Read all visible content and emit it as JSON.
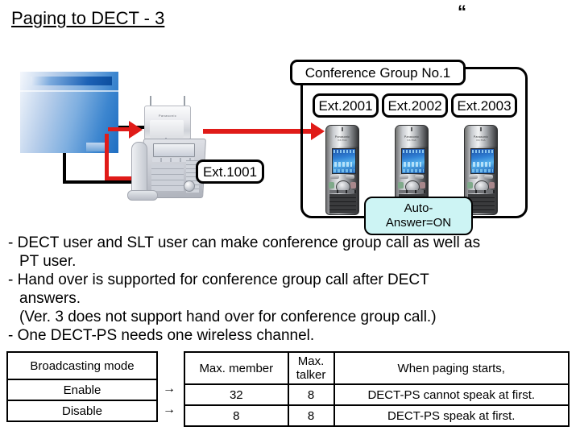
{
  "slide": {
    "title": "Paging to DECT - 3",
    "quote_mark": "“"
  },
  "diagram": {
    "conference_group_label": "Conference Group No.1",
    "extension_labels": [
      "Ext.2001",
      "Ext.2002",
      "Ext.2003"
    ],
    "pt_extension_label": "Ext.1001",
    "auto_answer": {
      "line1": "Auto-",
      "line2": "Answer=ON"
    },
    "devices": {
      "pbx": "pbx-main-unit",
      "cell_station": "dect-cell-station",
      "desk_phone": "proprietary-desk-telephone",
      "handsets": [
        "dect-handset-1",
        "dect-handset-2",
        "dect-handset-3"
      ]
    },
    "colors": {
      "arrow_red": "#e01b18",
      "callout_cyan": "#cdf4f4",
      "pbx_blue": "#1f6ec2"
    }
  },
  "notes": {
    "lines": [
      "- DECT user and SLT user can make conference group call as well as",
      "PT user.",
      "- Hand over is supported for conference group call after DECT",
      "answers.",
      "(Ver. 3 does not support hand over for conference group call.)",
      "- One DECT-PS needs one wireless channel."
    ]
  },
  "table": {
    "left_header": "Broadcasting mode",
    "headers": [
      "Max. member",
      "Max.",
      "talker",
      "When paging starts,"
    ],
    "header_member": "Max. member",
    "header_talker_l1": "Max.",
    "header_talker_l2": "talker",
    "header_note": "When paging starts,",
    "arrow_glyph": "→",
    "rows": [
      {
        "mode": "Enable",
        "arrow": "→",
        "max_member": "32",
        "max_talker": "8",
        "note": "DECT-PS cannot speak at first."
      },
      {
        "mode": "Disable",
        "arrow": "→",
        "max_member": "8",
        "max_talker": "8",
        "note": "DECT-PS speak at first."
      }
    ]
  }
}
